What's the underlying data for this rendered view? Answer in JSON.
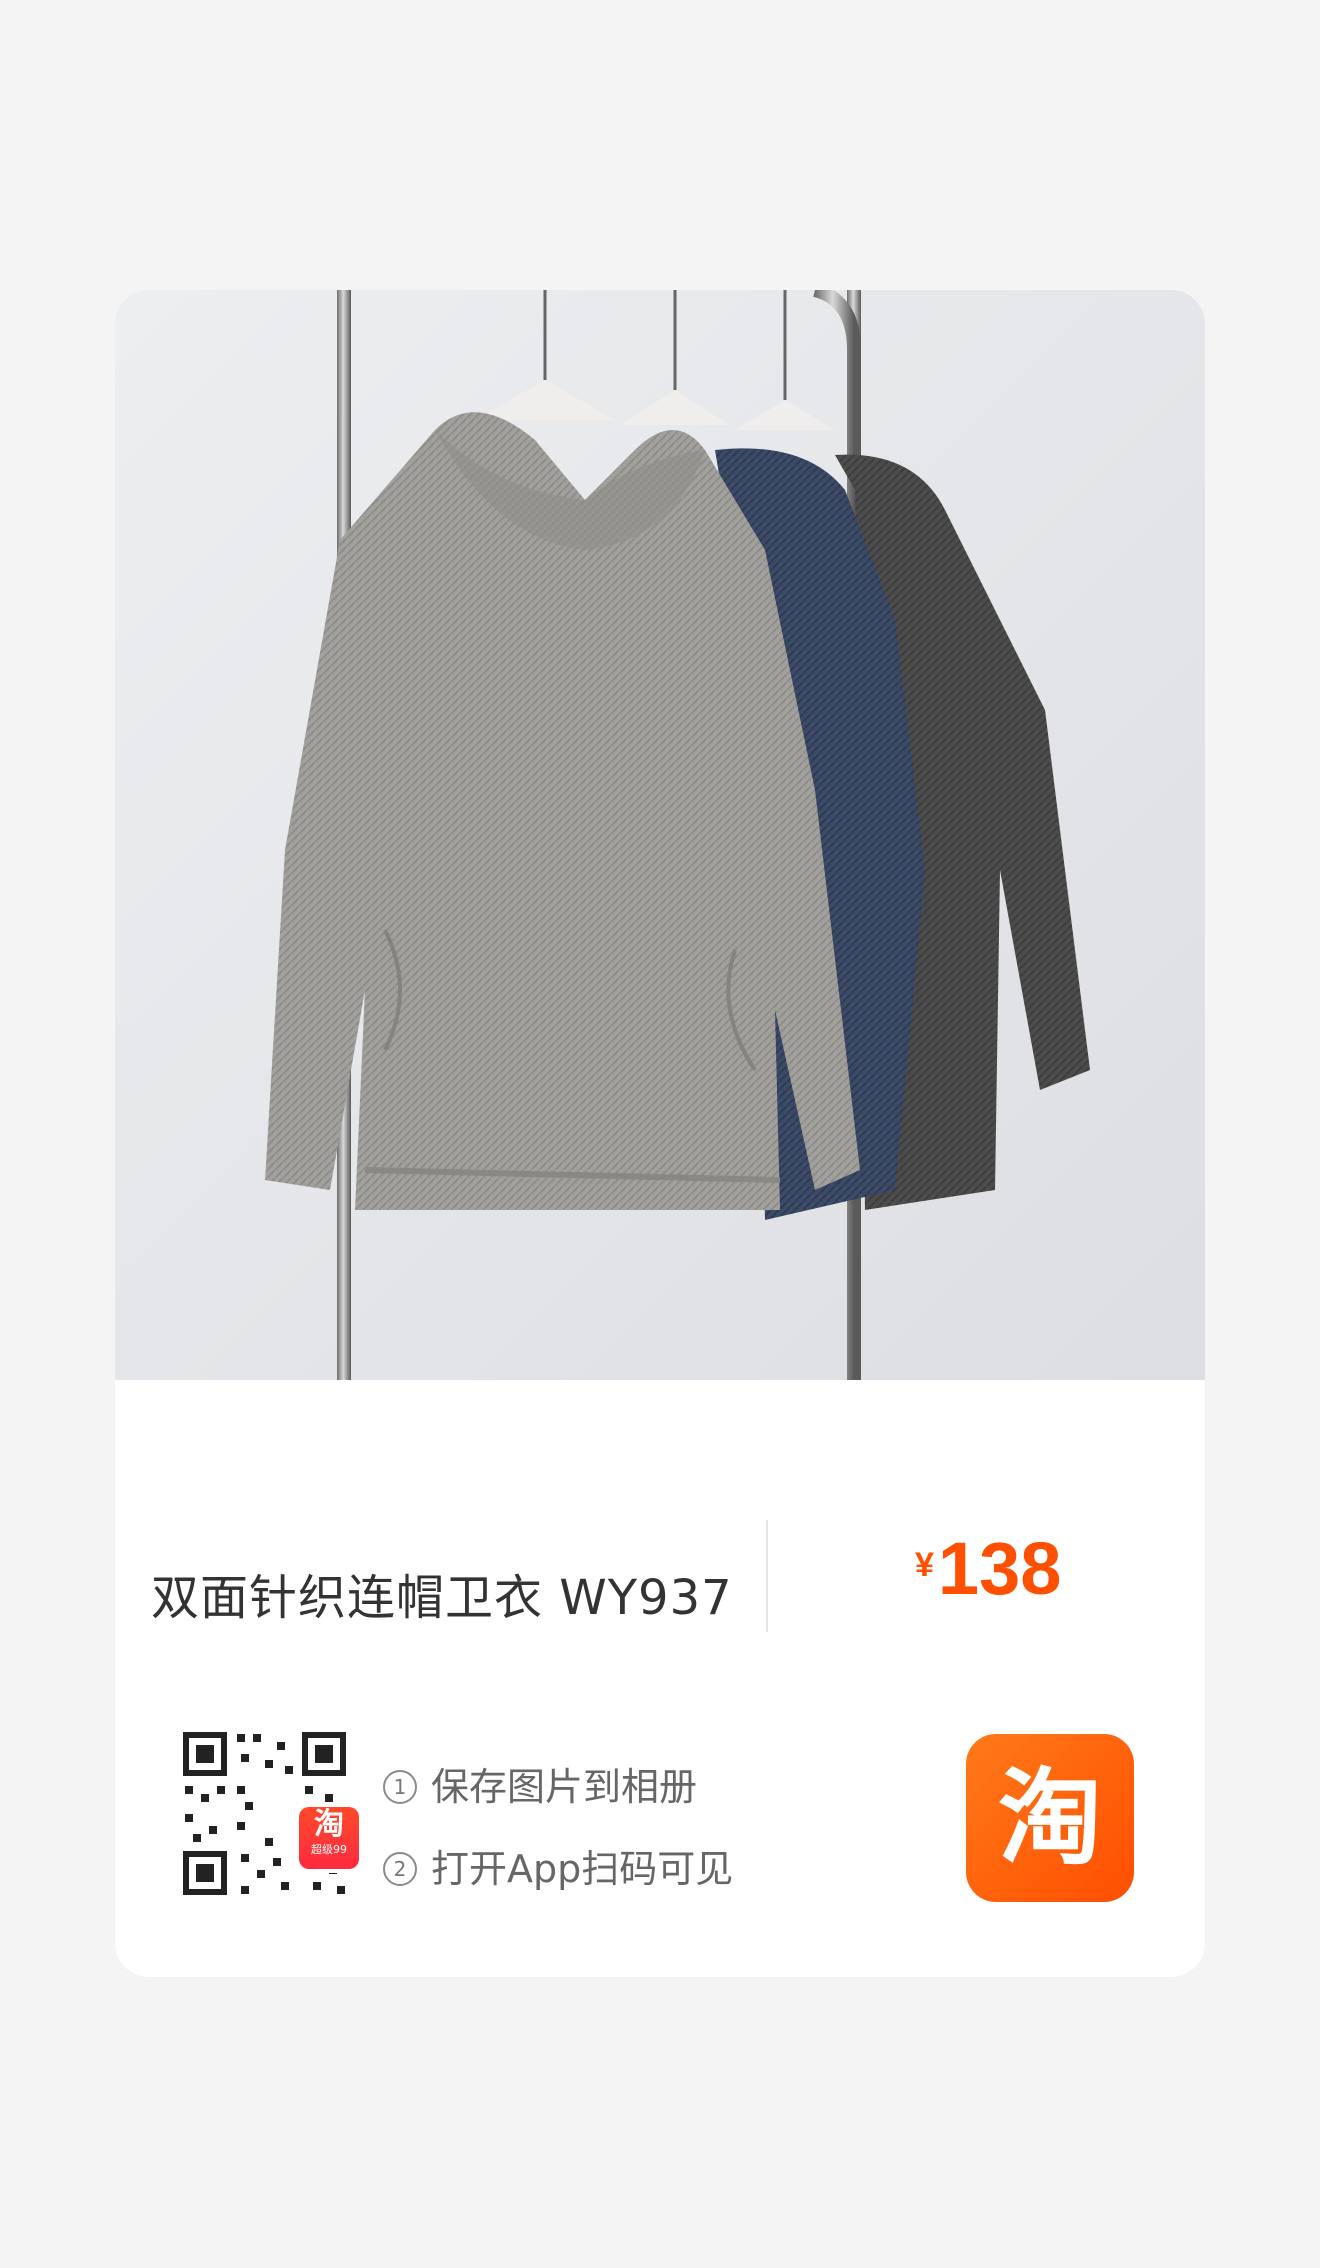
{
  "product": {
    "name": "双面针织连帽卫衣 WY937",
    "price_currency": "¥",
    "price_amount": "138"
  },
  "qr_section": {
    "qr_logo_glyph": "淘",
    "qr_logo_sub": "超级99",
    "steps": [
      {
        "num": "1",
        "text": "保存图片到相册"
      },
      {
        "num": "2",
        "text": "打开App扫码可见"
      }
    ]
  },
  "app_icon": {
    "glyph": "淘",
    "icon": "taobao-app-icon"
  },
  "colors": {
    "accent": "#ff5000",
    "background": "#f4f4f4",
    "card": "#ffffff"
  }
}
